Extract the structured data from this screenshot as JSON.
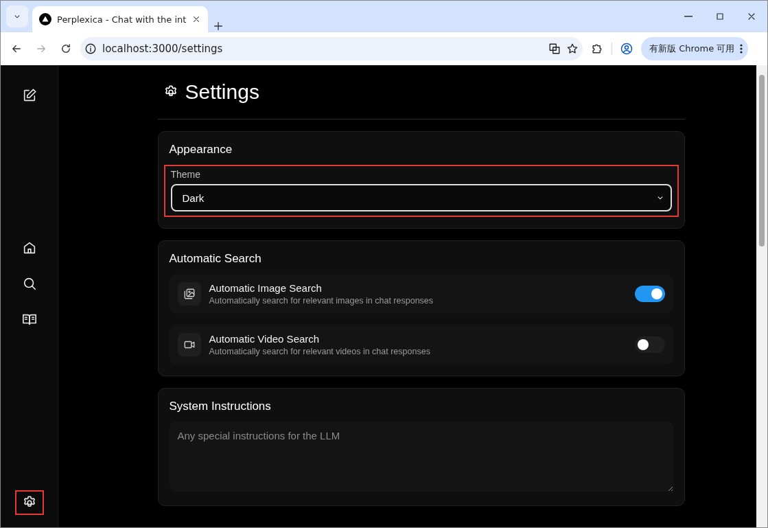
{
  "browser": {
    "tab": {
      "title": "Perplexica - Chat with the int",
      "selected": true
    },
    "url": "localhost:3000/settings",
    "update_button": "有新版 Chrome 可用"
  },
  "sidebar": {
    "items": [
      {
        "kind": "new",
        "highlighted": false
      },
      {
        "kind": "home",
        "highlighted": false
      },
      {
        "kind": "search",
        "highlighted": false
      },
      {
        "kind": "library",
        "highlighted": false
      },
      {
        "kind": "settings",
        "highlighted": true
      }
    ]
  },
  "page": {
    "title": "Settings",
    "appearance": {
      "title": "Appearance",
      "theme_label": "Theme",
      "theme_value": "Dark",
      "highlighted": true
    },
    "automatic_search": {
      "title": "Automatic Search",
      "items": [
        {
          "kind": "image",
          "title": "Automatic Image Search",
          "description": "Automatically search for relevant images in chat responses",
          "on": true
        },
        {
          "kind": "video",
          "title": "Automatic Video Search",
          "description": "Automatically search for relevant videos in chat responses",
          "on": false
        }
      ]
    },
    "system_instructions": {
      "title": "System Instructions",
      "placeholder": "Any special instructions for the LLM"
    }
  }
}
